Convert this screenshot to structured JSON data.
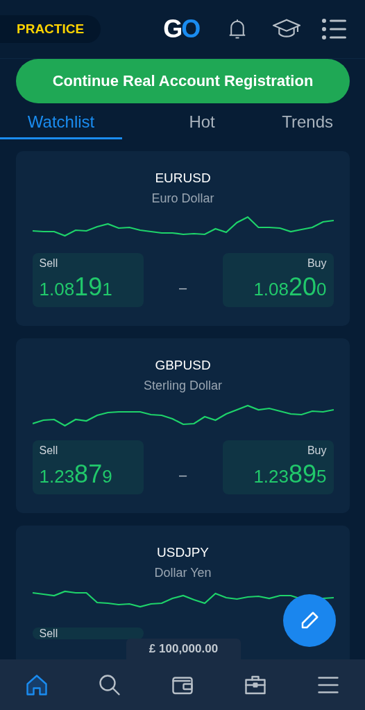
{
  "header": {
    "mode_badge": "PRACTICE",
    "logo": {
      "first": "G",
      "second": "O"
    }
  },
  "register_button": "Continue Real Account Registration",
  "tabs": [
    {
      "label": "Watchlist",
      "selected": true
    },
    {
      "label": "Hot",
      "selected": false
    },
    {
      "label": "Trends",
      "selected": false
    }
  ],
  "instruments": [
    {
      "symbol": "EURUSD",
      "name": "Euro  Dollar",
      "sell": {
        "label": "Sell",
        "main": "1.08",
        "pips": "19",
        "tail": "1"
      },
      "spread": "–",
      "buy": {
        "label": "Buy",
        "main": "1.08",
        "pips": "20",
        "tail": "0"
      }
    },
    {
      "symbol": "GBPUSD",
      "name": "Sterling Dollar",
      "sell": {
        "label": "Sell",
        "main": "1.23",
        "pips": "87",
        "tail": "9"
      },
      "spread": "–",
      "buy": {
        "label": "Buy",
        "main": "1.23",
        "pips": "89",
        "tail": "5"
      }
    },
    {
      "symbol": "USDJPY",
      "name": "Dollar Yen",
      "sell": {
        "label": "Sell"
      }
    }
  ],
  "balance": "£ 100,000.00",
  "bottom_nav": [
    {
      "kind": "home",
      "selected": true
    },
    {
      "kind": "search",
      "selected": false
    },
    {
      "kind": "wallet",
      "selected": false
    },
    {
      "kind": "briefcase",
      "selected": false
    },
    {
      "kind": "menu",
      "selected": false
    }
  ]
}
